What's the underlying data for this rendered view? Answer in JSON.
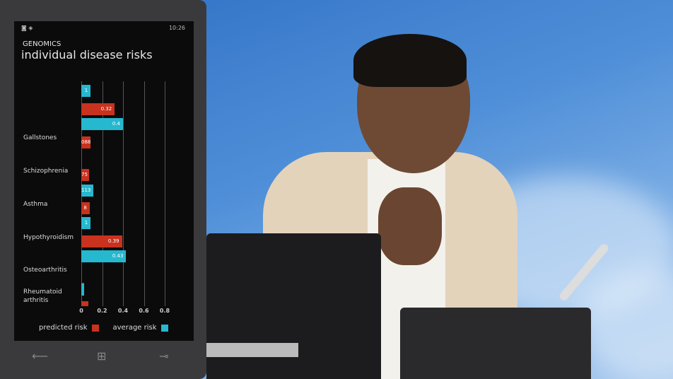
{
  "phone": {
    "status_time": "10:26",
    "category": "GENOMICS",
    "title": "individual disease risks",
    "nav": {
      "back": "back-arrow",
      "home": "windows-logo",
      "search": "search"
    }
  },
  "colors": {
    "predicted": "#c8321e",
    "average": "#26b8cf"
  },
  "chart_data": {
    "type": "bar",
    "orientation": "horizontal",
    "title": "individual disease risks",
    "xlabel": "",
    "ylabel": "",
    "xlim": [
      0,
      0.8
    ],
    "xticks": [
      "0",
      "0.2",
      "0.4",
      "0.6",
      "0.8"
    ],
    "grid": true,
    "legend": {
      "position": "bottom",
      "entries": [
        "predicted risk",
        "average risk"
      ]
    },
    "categories": [
      "(previous, partially visible)",
      "Gallstones",
      "Schizophrenia",
      "Asthma",
      "Hypothyroidism",
      "Osteoarthritis",
      "Rheumatoid arthritis",
      "(next, partially visible)"
    ],
    "labels_visible": [
      "",
      "Gallstones",
      "Schizophrenia",
      "Asthma",
      "Hypothyroidism",
      "Osteoarthritis",
      "Rheumatoid arthritis",
      ""
    ],
    "series": [
      {
        "name": "predicted risk",
        "values": [
          null,
          0.32,
          0.088,
          0.075,
          0.08,
          0.39,
          0.002,
          0.07
        ],
        "data_labels": [
          "",
          "0.32",
          "088",
          "75",
          "8",
          "0.39",
          "",
          ""
        ]
      },
      {
        "name": "average risk",
        "values": [
          0.09,
          0.4,
          null,
          0.113,
          0.09,
          0.43,
          0.03,
          null
        ],
        "data_labels": [
          "1",
          "0.4",
          "",
          "113",
          "1",
          "0.43",
          "",
          ""
        ]
      }
    ]
  }
}
